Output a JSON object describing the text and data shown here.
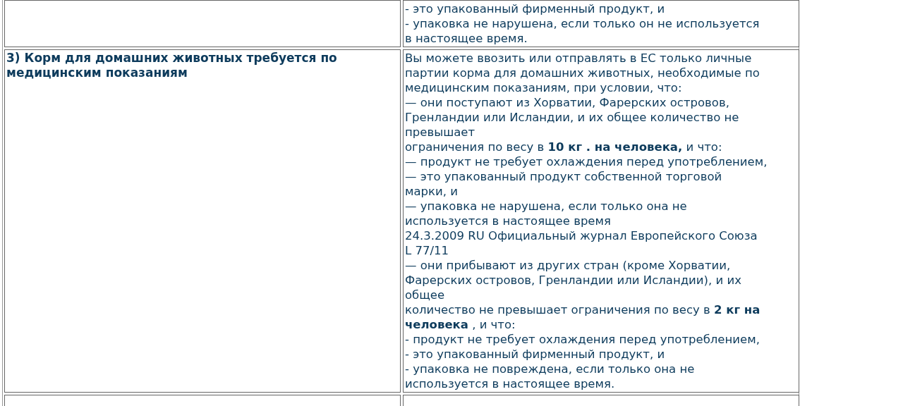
{
  "table": {
    "rows": [
      {
        "lines": [
          "- это упакованный фирменный продукт, и",
          "- упаковка не нарушена, если только он не используется",
          "в настоящее время."
        ]
      },
      {
        "heading": "3) Корм для домашних животных требуется по медицинским показаниям",
        "lines": [
          "Вы можете ввозить или отправлять в ЕС только личные",
          "партии корма для домашних животных, необходимые по",
          "медицинским показаниям, при условии, что:",
          "— они поступают из Хорватии, Фарерских островов,",
          "Гренландии или Исландии, и их общее количество не",
          "превышает",
          "ограничения по весу в **10 кг . на человека,** и что:",
          "— продукт не требует охлаждения перед употреблением,",
          "— это упакованный продукт собственной торговой",
          "марки, и",
          "— упаковка не нарушена, если только она не",
          "используется в настоящее время",
          "24.3.2009 RU Официальный журнал Европейского Союза",
          "L 77/11",
          "— они прибывают из других стран (кроме Хорватии,",
          "Фарерских островов, Гренландии или Исландии), и их",
          "общее",
          "количество не превышает ограничения по весу в **2 кг на**",
          "**человека** , и что:",
          "- продукт не требует охлаждения перед употреблением,",
          "- это упакованный фирменный продукт, и",
          "- упаковка не повреждена, если только она не",
          "используется в настоящее время."
        ]
      }
    ]
  }
}
